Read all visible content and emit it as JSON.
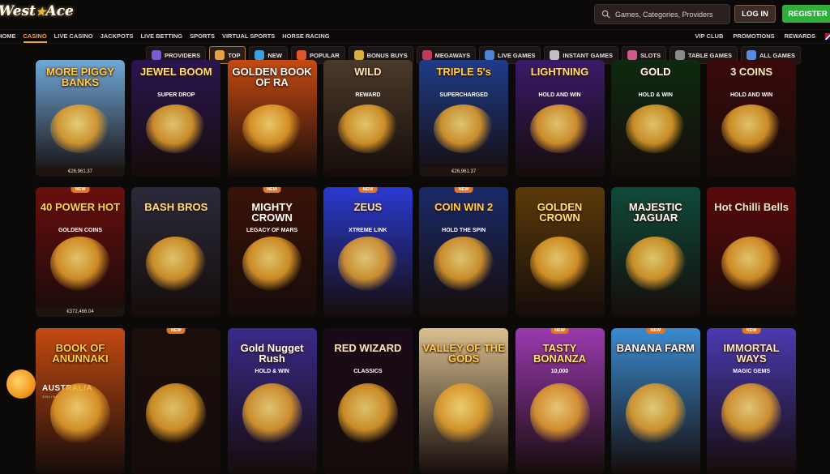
{
  "header": {
    "logo_text": "West",
    "logo_text2": "Ace",
    "search_placeholder": "Games, Categories, Providers",
    "login_label": "LOG IN",
    "register_label": "REGISTER"
  },
  "nav": {
    "left": [
      "HOME",
      "CASINO",
      "LIVE CASINO",
      "JACKPOTS",
      "LIVE BETTING",
      "SPORTS",
      "VIRTUAL SPORTS",
      "HORSE RACING"
    ],
    "active": "CASINO",
    "right": [
      "VIP CLUB",
      "PROMOTIONS",
      "REWARDS"
    ]
  },
  "categories": [
    {
      "label": "PROVIDERS",
      "icon": "providers-icon",
      "color": "#7a5bd1"
    },
    {
      "label": "TOP",
      "icon": "top-icon",
      "color": "#e8a240",
      "active": true
    },
    {
      "label": "NEW",
      "icon": "new-icon",
      "color": "#3aa0e0"
    },
    {
      "label": "POPULAR",
      "icon": "popular-icon",
      "color": "#e0542e"
    },
    {
      "label": "BONUS BUYS",
      "icon": "bonus-buys-icon",
      "color": "#d6b23a"
    },
    {
      "label": "MEGAWAYS",
      "icon": "megaways-icon",
      "color": "#c23a5a"
    },
    {
      "label": "LIVE GAMES",
      "icon": "live-games-icon",
      "color": "#4a86d6"
    },
    {
      "label": "INSTANT GAMES",
      "icon": "instant-games-icon",
      "color": "#c0c0c0"
    },
    {
      "label": "SLOTS",
      "icon": "slots-icon",
      "color": "#d05a8a"
    },
    {
      "label": "TABLE GAMES",
      "icon": "table-games-icon",
      "color": "#8a8a8a"
    },
    {
      "label": "ALL GAMES",
      "icon": "all-games-icon",
      "color": "#5a8ae0"
    }
  ],
  "games": {
    "row1": [
      {
        "title": "MORE PIGGY BANKS",
        "jackpot": "€26,961.37",
        "bg": "#6fa8d8"
      },
      {
        "title": "JEWEL BOOM",
        "sub": "SUPER DROP",
        "bg": "#2a1550"
      },
      {
        "title": "GOLDEN BOOK OF RA",
        "bg": "#c44a12"
      },
      {
        "title": "WILD",
        "sub": "REWARD",
        "bg": "#4a3a2a"
      },
      {
        "title": "TRIPLE 5's",
        "sub": "SUPERCHARGED",
        "jackpot": "€26,961.37",
        "bg": "#1e3c8a"
      },
      {
        "title": "LIGHTNING",
        "sub": "HOLD AND WIN",
        "bg": "#3a1a6a"
      },
      {
        "title": "GOLD",
        "sub": "HOLD & WIN",
        "bg": "#0e2a10"
      },
      {
        "title": "3 COINS",
        "sub": "HOLD AND WIN",
        "bg": "#3a0a0a"
      }
    ],
    "row2": [
      {
        "title": "40 POWER HOT",
        "sub": "GOLDEN COINS",
        "jackpot": "€372,466.04",
        "badge": "NEW",
        "bg": "#6a0e0e"
      },
      {
        "title": "BASH BROS",
        "bg": "#2a2a3a"
      },
      {
        "title": "MIGHTY CROWN",
        "sub": "LEGACY OF MARS",
        "badge": "NEW",
        "bg": "#3a1208"
      },
      {
        "title": "ZEUS",
        "sub": "XTREME LINK",
        "badge": "NEW",
        "bg": "#2a3ad0"
      },
      {
        "title": "COIN WIN 2",
        "sub": "HOLD THE SPIN",
        "badge": "NEW",
        "bg": "#1a2a6a"
      },
      {
        "title": "GOLDEN CROWN",
        "bg": "#5a3a0a"
      },
      {
        "title": "MAJESTIC JAGUAR",
        "bg": "#0e4a3a"
      },
      {
        "title": "Hot Chilli Bells",
        "bg": "#5a0a0a"
      }
    ],
    "row3": [
      {
        "title": "BOOK OF ANUNNAKI",
        "bg": "#c44a12"
      },
      {
        "title": "",
        "badge": "NEW",
        "bg": "#1a0e0a"
      },
      {
        "title": "Gold Nugget Rush",
        "sub": "HOLD & WIN",
        "bg": "#3a2a8a"
      },
      {
        "title": "RED WIZARD",
        "sub": "CLASSICS",
        "bg": "#1a0a1a"
      },
      {
        "title": "VALLEY OF THE GODS",
        "bg": "#d8c090"
      },
      {
        "title": "TASTY BONANZA",
        "sub": "10,000",
        "badge": "NEW",
        "bg": "#9a3ab0"
      },
      {
        "title": "BANANA FARM",
        "badge": "NEW",
        "bg": "#3a8ad0"
      },
      {
        "title": "IMMORTAL WAYS",
        "sub": "MAGIC GEMS",
        "badge": "NEW",
        "bg": "#4a3ab0"
      }
    ]
  },
  "watermark": {
    "text": "AUSTRALIA",
    "sub": "ONLINE"
  }
}
